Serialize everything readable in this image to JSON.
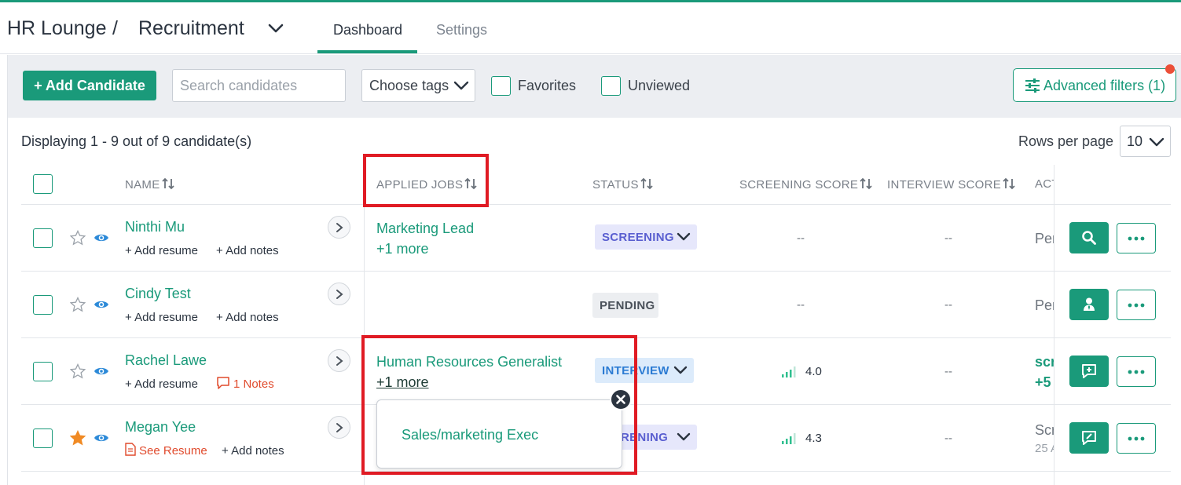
{
  "header": {
    "breadcrumb": [
      "HR Lounge",
      "Recruitment"
    ],
    "separator": "/",
    "tabs": [
      {
        "label": "Dashboard",
        "active": true
      },
      {
        "label": "Settings",
        "active": false
      }
    ]
  },
  "toolbar": {
    "add_candidate": "+ Add Candidate",
    "search_placeholder": "Search candidates",
    "tags_label": "Choose tags",
    "favorites_label": "Favorites",
    "unviewed_label": "Unviewed",
    "advanced_filters": "Advanced filters (1)"
  },
  "table": {
    "display_text": "Displaying 1 - 9 out of 9 candidate(s)",
    "rows_per_page_label": "Rows per page",
    "rows_per_page_value": "10",
    "columns": [
      "NAME",
      "APPLIED JOBS",
      "STATUS",
      "SCREENING SCORE",
      "INTERVIEW SCORE",
      "ACT"
    ],
    "add_resume": "+ Add resume",
    "add_notes": "+ Add notes",
    "empty_value": "--",
    "rows": [
      {
        "name": "Ninthi Mu",
        "favorite": false,
        "resume": "+ Add resume",
        "notes": "+ Add notes",
        "job": "Marketing Lead",
        "more": "+1 more",
        "status": "SCREENING",
        "screening_score": "--",
        "interview_score": "--",
        "activity": "Per"
      },
      {
        "name": "Cindy Test",
        "favorite": false,
        "resume": "+ Add resume",
        "notes": "+ Add notes",
        "job": "",
        "more": "",
        "status": "PENDING",
        "screening_score": "--",
        "interview_score": "--",
        "activity": "Per"
      },
      {
        "name": "Rachel Lawe",
        "favorite": false,
        "resume": "+ Add resume",
        "notes": "1 Notes",
        "job": "Human Resources Generalist",
        "more": "+1 more",
        "status": "INTERVIEW",
        "screening_score": "4.0",
        "interview_score": "--",
        "activity": "scr",
        "activity2": "+5"
      },
      {
        "name": "Megan Yee",
        "favorite": true,
        "resume": "See Resume",
        "notes": "+ Add notes",
        "job": "",
        "more": "",
        "status": "SCREENING",
        "status_visible": "RENING",
        "screening_score": "4.3",
        "interview_score": "--",
        "activity": "Scr",
        "activity2": "25 A"
      }
    ]
  },
  "popup": {
    "item": "Sales/marketing Exec"
  },
  "colors": {
    "accent": "#1a9a7a",
    "highlight": "#e01b24",
    "notification": "#ec4f38"
  }
}
